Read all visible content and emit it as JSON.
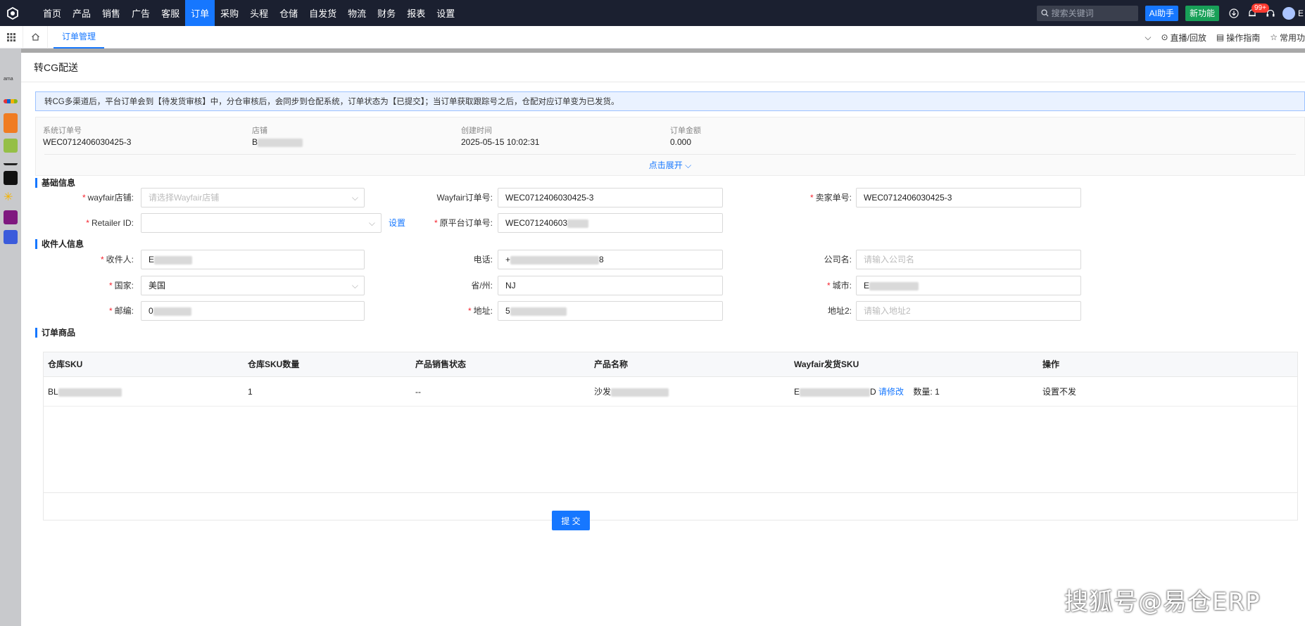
{
  "nav": {
    "items": [
      "首页",
      "产品",
      "销售",
      "广告",
      "客服",
      "订单",
      "采购",
      "头程",
      "仓储",
      "自发货",
      "物流",
      "财务",
      "报表",
      "设置"
    ],
    "active_index": 5,
    "search_placeholder": "搜索关键词",
    "ai_label": "AI助手",
    "new_label": "新功能",
    "badge": "99+",
    "user": "E"
  },
  "tabbar": {
    "tab": "订单管理",
    "live": "直播/回放",
    "guide": "操作指南",
    "common": "常用功"
  },
  "modal": {
    "title": "转CG配送",
    "alert": "转CG多渠道后，平台订单会到【待发货审核】中，分仓审核后，会同步到仓配系统，订单状态为【已提交】；当订单获取跟踪号之后，仓配对应订单变为已发货。",
    "summary": {
      "order_no_label": "系统订单号",
      "order_no": "WEC0712406030425-3",
      "shop_label": "店铺",
      "shop": "B",
      "created_label": "创建时间",
      "created": "2025-05-15 10:02:31",
      "amount_label": "订单金额",
      "amount": "0.000",
      "expand": "点击展开"
    },
    "basic": {
      "title": "基础信息",
      "shop_label": "wayfair店铺:",
      "shop_placeholder": "请选择Wayfair店铺",
      "wf_order_label": "Wayfair订单号:",
      "wf_order": "WEC0712406030425-3",
      "seller_no_label": "卖家单号:",
      "seller_no": "WEC0712406030425-3",
      "retailer_label": "Retailer ID:",
      "retailer_value": "",
      "settings": "设置",
      "orig_order_label": "原平台订单号:",
      "orig_order": "WEC071240603"
    },
    "recipient": {
      "title": "收件人信息",
      "name_label": "收件人:",
      "name": "E",
      "phone_label": "电话:",
      "phone": "+",
      "phone_end": "8",
      "company_label": "公司名:",
      "company_placeholder": "请输入公司名",
      "country_label": "国家:",
      "country": "美国",
      "state_label": "省/州:",
      "state": "NJ",
      "city_label": "城市:",
      "city": "E",
      "zip_label": "邮编:",
      "zip": "0",
      "address_label": "地址:",
      "address": "5",
      "address2_label": "地址2:",
      "address2_placeholder": "请输入地址2"
    },
    "items": {
      "title": "订单商品",
      "headers": [
        "仓库SKU",
        "仓库SKU数量",
        "产品销售状态",
        "产品名称",
        "Wayfair发货SKU",
        "操作"
      ],
      "row": {
        "sku": "BL",
        "qty": "1",
        "status": "--",
        "name": "沙发",
        "wf_sku_start": "E",
        "wf_sku_end": "D",
        "edit": "请修改",
        "count_label": "数量:",
        "count": "1",
        "action": "设置不发"
      }
    },
    "submit": "提 交"
  },
  "watermark": "搜狐号@易仓ERP"
}
